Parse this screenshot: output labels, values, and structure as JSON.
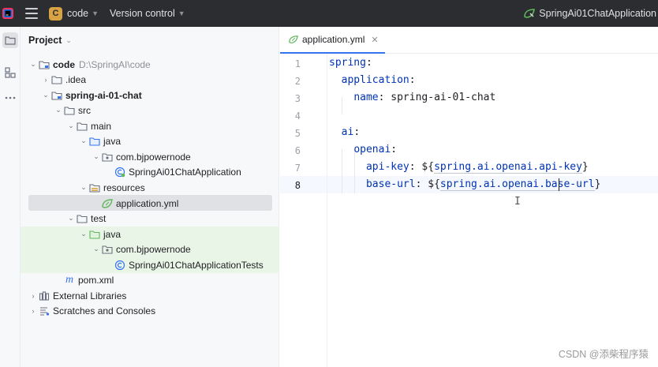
{
  "titlebar": {
    "project_badge": "C",
    "project_name": "code",
    "vcs_label": "Version control",
    "run_config": "SpringAi01ChatApplication"
  },
  "project_panel": {
    "title": "Project",
    "tree": [
      {
        "label": "code",
        "path": "D:\\SpringAI\\code",
        "icon": "module-folder-icon"
      },
      {
        "label": ".idea",
        "icon": "folder-icon"
      },
      {
        "label": "spring-ai-01-chat",
        "icon": "module-folder-icon"
      },
      {
        "label": "src",
        "icon": "folder-icon"
      },
      {
        "label": "main",
        "icon": "folder-icon"
      },
      {
        "label": "java",
        "icon": "source-folder-icon"
      },
      {
        "label": "com.bjpowernode",
        "icon": "package-icon"
      },
      {
        "label": "SpringAi01ChatApplication",
        "icon": "spring-class-icon"
      },
      {
        "label": "resources",
        "icon": "resources-folder-icon"
      },
      {
        "label": "application.yml",
        "icon": "spring-yml-icon"
      },
      {
        "label": "test",
        "icon": "folder-icon"
      },
      {
        "label": "java",
        "icon": "test-source-folder-icon"
      },
      {
        "label": "com.bjpowernode",
        "icon": "package-icon"
      },
      {
        "label": "SpringAi01ChatApplicationTests",
        "icon": "spring-class-icon"
      },
      {
        "label": "pom.xml",
        "icon": "maven-icon"
      },
      {
        "label": "External Libraries",
        "icon": "library-icon"
      },
      {
        "label": "Scratches and Consoles",
        "icon": "scratches-icon"
      }
    ]
  },
  "editor": {
    "tab_label": "application.yml",
    "line_numbers": [
      "1",
      "2",
      "3",
      "4",
      "5",
      "6",
      "7",
      "8"
    ],
    "lines": {
      "l1_key": "spring",
      "l2_key": "application",
      "l3_key": "name",
      "l3_value": "spring-ai-01-chat",
      "l5_key": "ai",
      "l6_key": "openai",
      "l7_key": "api-key",
      "l7_ref": "spring.ai.openai.api-key",
      "l8_key": "base-url",
      "l8_ref": "spring.ai.openai.base-url"
    }
  },
  "watermark": "CSDN @添柴程序猿",
  "colors": {
    "titlebar_bg": "#2b2d30",
    "yaml_key": "#0033b3",
    "selection_bg": "#dfe1e5",
    "test_bg": "#e9f5e6",
    "tab_underline": "#3574f0"
  }
}
